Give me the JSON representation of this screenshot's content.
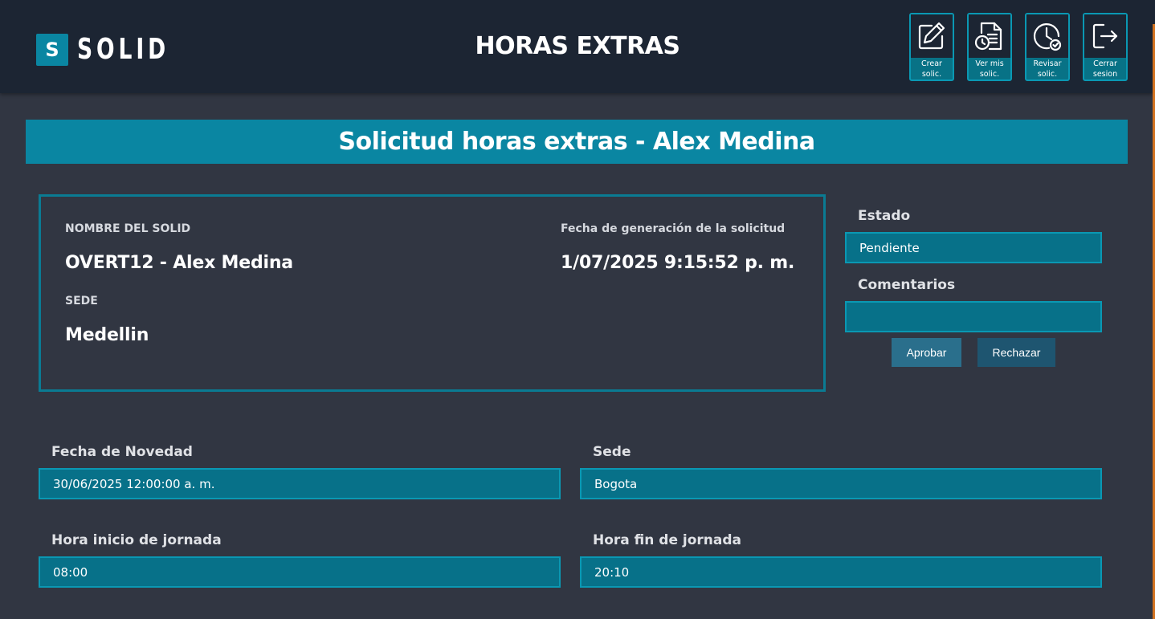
{
  "header": {
    "logo_letter": "S",
    "logo_text": "SOLID",
    "title": "HORAS EXTRAS",
    "nav": [
      {
        "label_line1": "Crear",
        "label_line2": "solic.",
        "icon": "edit-icon"
      },
      {
        "label_line1": "Ver mis",
        "label_line2": "solic.",
        "icon": "document-clock-icon"
      },
      {
        "label_line1": "Revisar",
        "label_line2": "solic.",
        "icon": "clock-check-icon"
      },
      {
        "label_line1": "Cerrar",
        "label_line2": "sesion",
        "icon": "logout-icon"
      }
    ]
  },
  "banner": {
    "title": "Solicitud horas extras - Alex Medina"
  },
  "info": {
    "name_label": "NOMBRE DEL SOLID",
    "name_value": "OVERT12 - Alex Medina",
    "sede_label": "SEDE",
    "sede_value": "Medellin",
    "date_label": "Fecha de generación de la solicitud",
    "date_value": "1/07/2025 9:15:52 p. m."
  },
  "review": {
    "estado_label": "Estado",
    "estado_value": "Pendiente",
    "comentarios_label": "Comentarios",
    "comentarios_value": "",
    "approve_label": "Aprobar",
    "reject_label": "Rechazar"
  },
  "form": {
    "fecha_novedad_label": "Fecha de Novedad",
    "fecha_novedad_value": "30/06/2025 12:00:00 a. m.",
    "sede_label": "Sede",
    "sede_value": "Bogota",
    "hora_inicio_label": "Hora inicio de jornada",
    "hora_inicio_value": "08:00",
    "hora_fin_label": "Hora fin de jornada",
    "hora_fin_value": "20:10"
  },
  "colors": {
    "background": "#313642",
    "header": "#1c2533",
    "accent": "#0a86a2",
    "field": "#077189",
    "approve_button": "#2a6f8c",
    "reject_button": "#1e5570",
    "stripe": "#d2721f"
  }
}
